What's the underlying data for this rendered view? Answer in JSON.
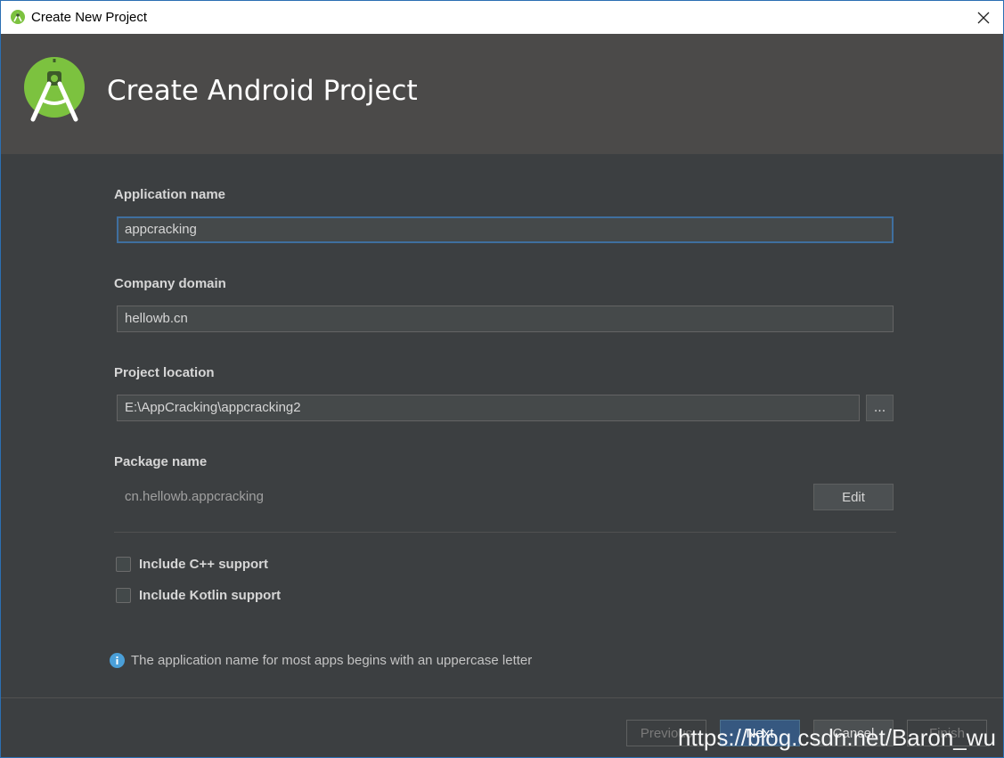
{
  "window": {
    "title": "Create New Project"
  },
  "header": {
    "title": "Create Android Project"
  },
  "form": {
    "app_name_label": "Application name",
    "app_name_value": "appcracking",
    "company_label": "Company domain",
    "company_value": "hellowb.cn",
    "location_label": "Project location",
    "location_value": "E:\\AppCracking\\appcracking2",
    "browse_label": "...",
    "package_label": "Package name",
    "package_value": "cn.hellowb.appcracking",
    "edit_label": "Edit",
    "cpp_label": "Include C++ support",
    "kotlin_label": "Include Kotlin support",
    "info_text": "The application name for most apps begins with an uppercase letter"
  },
  "footer": {
    "previous_label": "Previous",
    "next_label": "Next",
    "cancel_label": "Cancel",
    "finish_label": "Finish"
  },
  "watermark": "https://blog.csdn.net/Baron_wu",
  "colors": {
    "title_bar": "#ffffff",
    "header_bg": "#4b4a49",
    "content_bg": "#3c3f41",
    "primary_button": "#365880",
    "android_green": "#7cc23f",
    "info_blue": "#4a9fd8"
  },
  "icons": {
    "title": "android-studio-icon",
    "logo": "android-studio-logo",
    "close": "close-icon",
    "info": "info-icon"
  }
}
